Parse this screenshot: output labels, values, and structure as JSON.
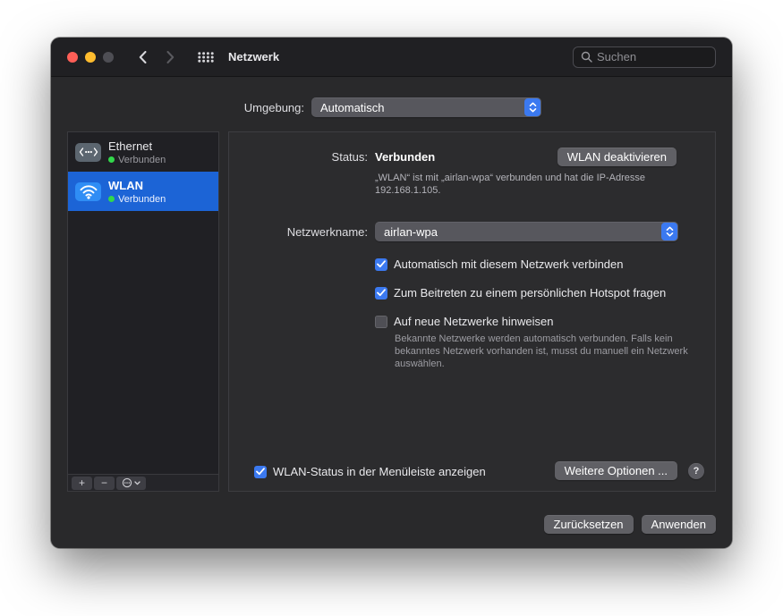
{
  "titlebar": {
    "title": "Netzwerk",
    "search_placeholder": "Suchen"
  },
  "environment": {
    "label": "Umgebung:",
    "value": "Automatisch"
  },
  "sidebar": {
    "items": [
      {
        "name": "Ethernet",
        "status": "Verbunden"
      },
      {
        "name": "WLAN",
        "status": "Verbunden"
      }
    ],
    "add_label": "+",
    "remove_label": "−"
  },
  "panel": {
    "status_label": "Status:",
    "status_value": "Verbunden",
    "deactivate_button": "WLAN deaktivieren",
    "status_description": "„WLAN“ ist mit „airlan-wpa“ verbunden und hat die IP-Adresse 192.168.1.105.",
    "network_name_label": "Netzwerkname:",
    "network_name_value": "airlan-wpa",
    "checkboxes": [
      {
        "label": "Automatisch mit diesem Netzwerk verbinden",
        "checked": true
      },
      {
        "label": "Zum Beitreten zu einem persönlichen Hotspot fragen",
        "checked": true
      },
      {
        "label": "Auf neue Netzwerke hinweisen",
        "checked": false
      }
    ],
    "help_text": "Bekannte Netzwerke werden automatisch verbunden. Falls kein bekanntes Netzwerk vorhanden ist, musst du manuell ein Netzwerk auswählen.",
    "menubar_checkbox": {
      "label": "WLAN-Status in der Menüleiste anzeigen",
      "checked": true
    },
    "advanced_button": "Weitere Optionen ...",
    "help_button": "?"
  },
  "footer": {
    "revert_button": "Zurücksetzen",
    "apply_button": "Anwenden"
  },
  "colors": {
    "accent": "#3b79f0",
    "selection": "#1c64d6",
    "status_green": "#32d74b"
  }
}
